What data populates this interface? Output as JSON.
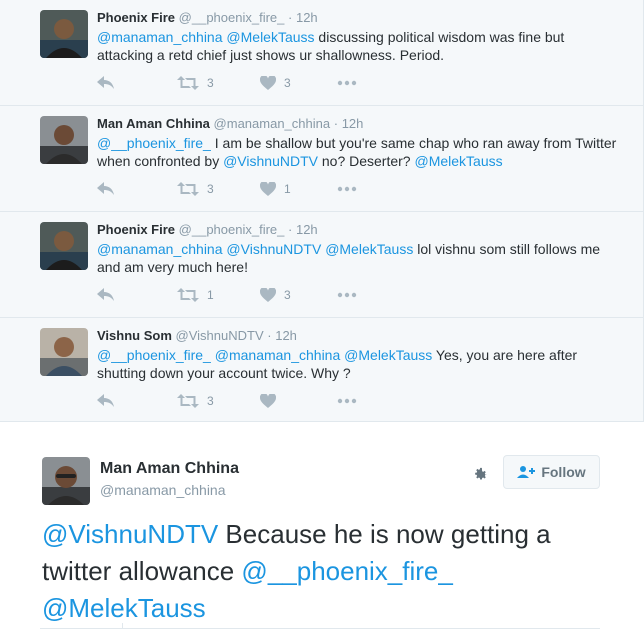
{
  "replies": [
    {
      "name": "Phoenix Fire",
      "handle": "@__phoenix_fire_",
      "dot": "·",
      "time": "12h",
      "text_parts": [
        "@manaman_chhina",
        " ",
        "@MelekTauss",
        " discussing political wisdom was fine but attacking a retd chief just shows ur shallowness. Period."
      ],
      "retweets": "3",
      "likes": "3",
      "avatar": "phoenix-avatar"
    },
    {
      "name": "Man Aman Chhina",
      "handle": "@manaman_chhina",
      "dot": "·",
      "time": "12h",
      "text_parts": [
        "@__phoenix_fire_",
        " I am be shallow but you're same chap who ran away from Twitter when confronted by ",
        "@VishnuNDTV",
        "  no? Deserter? ",
        "@MelekTauss"
      ],
      "retweets": "3",
      "likes": "1",
      "avatar": "manaman-avatar"
    },
    {
      "name": "Phoenix Fire",
      "handle": "@__phoenix_fire_",
      "dot": "·",
      "time": "12h",
      "text_parts": [
        "@manaman_chhina",
        " ",
        "@VishnuNDTV",
        " ",
        "@MelekTauss",
        " lol vishnu som still follows me and am very much here!"
      ],
      "retweets": "1",
      "likes": "3",
      "avatar": "phoenix-avatar"
    },
    {
      "name": "Vishnu Som",
      "handle": "@VishnuNDTV",
      "dot": "·",
      "time": "12h",
      "text_parts": [
        "@__phoenix_fire_",
        " ",
        "@manaman_chhina",
        " ",
        "@MelekTauss",
        " Yes, you are here after shutting down your account twice. Why ?"
      ],
      "retweets": "3",
      "likes": "",
      "avatar": "vishnu-avatar"
    }
  ],
  "main_tweet": {
    "name": "Man Aman Chhina",
    "handle": "@manaman_chhina",
    "follow_label": "Follow",
    "text_parts": [
      "@VishnuNDTV",
      " Because he is now getting a twitter allowance ",
      "@__phoenix_fire_",
      " ",
      "@MelekTauss"
    ]
  },
  "colors": {
    "link": "#1b95e0",
    "action_icon": "#aab8c2",
    "background_thread": "#f5f8fa"
  },
  "icons": [
    "reply-icon",
    "retweet-icon",
    "like-icon",
    "more-icon",
    "gear-icon",
    "follow-person-icon"
  ]
}
